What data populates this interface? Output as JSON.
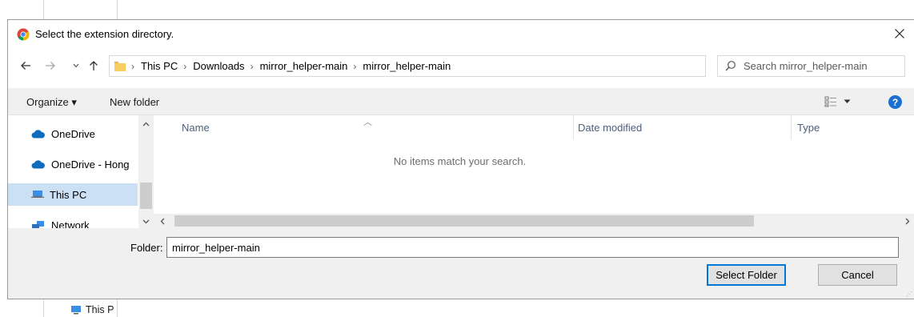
{
  "background": {
    "item_label": "This P"
  },
  "dialog": {
    "title": "Select the extension directory.",
    "close_icon": "close-icon"
  },
  "nav": {
    "back_icon": "back-arrow-icon",
    "forward_icon": "forward-arrow-icon",
    "recent_icon": "chevron-down-icon",
    "up_icon": "up-arrow-icon",
    "breadcrumbs": [
      "This PC",
      "Downloads",
      "mirror_helper-main",
      "mirror_helper-main"
    ],
    "refresh_icon": "refresh-icon",
    "search_placeholder": "Search mirror_helper-main"
  },
  "toolbar": {
    "organize_label": "Organize ▾",
    "new_folder_label": "New folder",
    "view_icon": "view-options-icon",
    "help_icon": "help-icon",
    "help_glyph": "?"
  },
  "sidebar": {
    "items": [
      {
        "label": "OneDrive",
        "icon": "cloud-icon",
        "selected": false
      },
      {
        "label": "OneDrive - Hong",
        "icon": "cloud-icon",
        "selected": false
      },
      {
        "label": "This PC",
        "icon": "computer-icon",
        "selected": true
      },
      {
        "label": "Network",
        "icon": "network-icon",
        "selected": false
      }
    ]
  },
  "filelist": {
    "columns": [
      "Name",
      "Date modified",
      "Type"
    ],
    "empty_message": "No items match your search."
  },
  "bottom": {
    "folder_label": "Folder:",
    "folder_value": "mirror_helper-main",
    "select_folder_label": "Select Folder",
    "cancel_label": "Cancel"
  },
  "colors": {
    "accent": "#0078d7",
    "selection": "#cce0f5",
    "help": "#1a6fd1",
    "onedrive": "#0f6cbd"
  }
}
